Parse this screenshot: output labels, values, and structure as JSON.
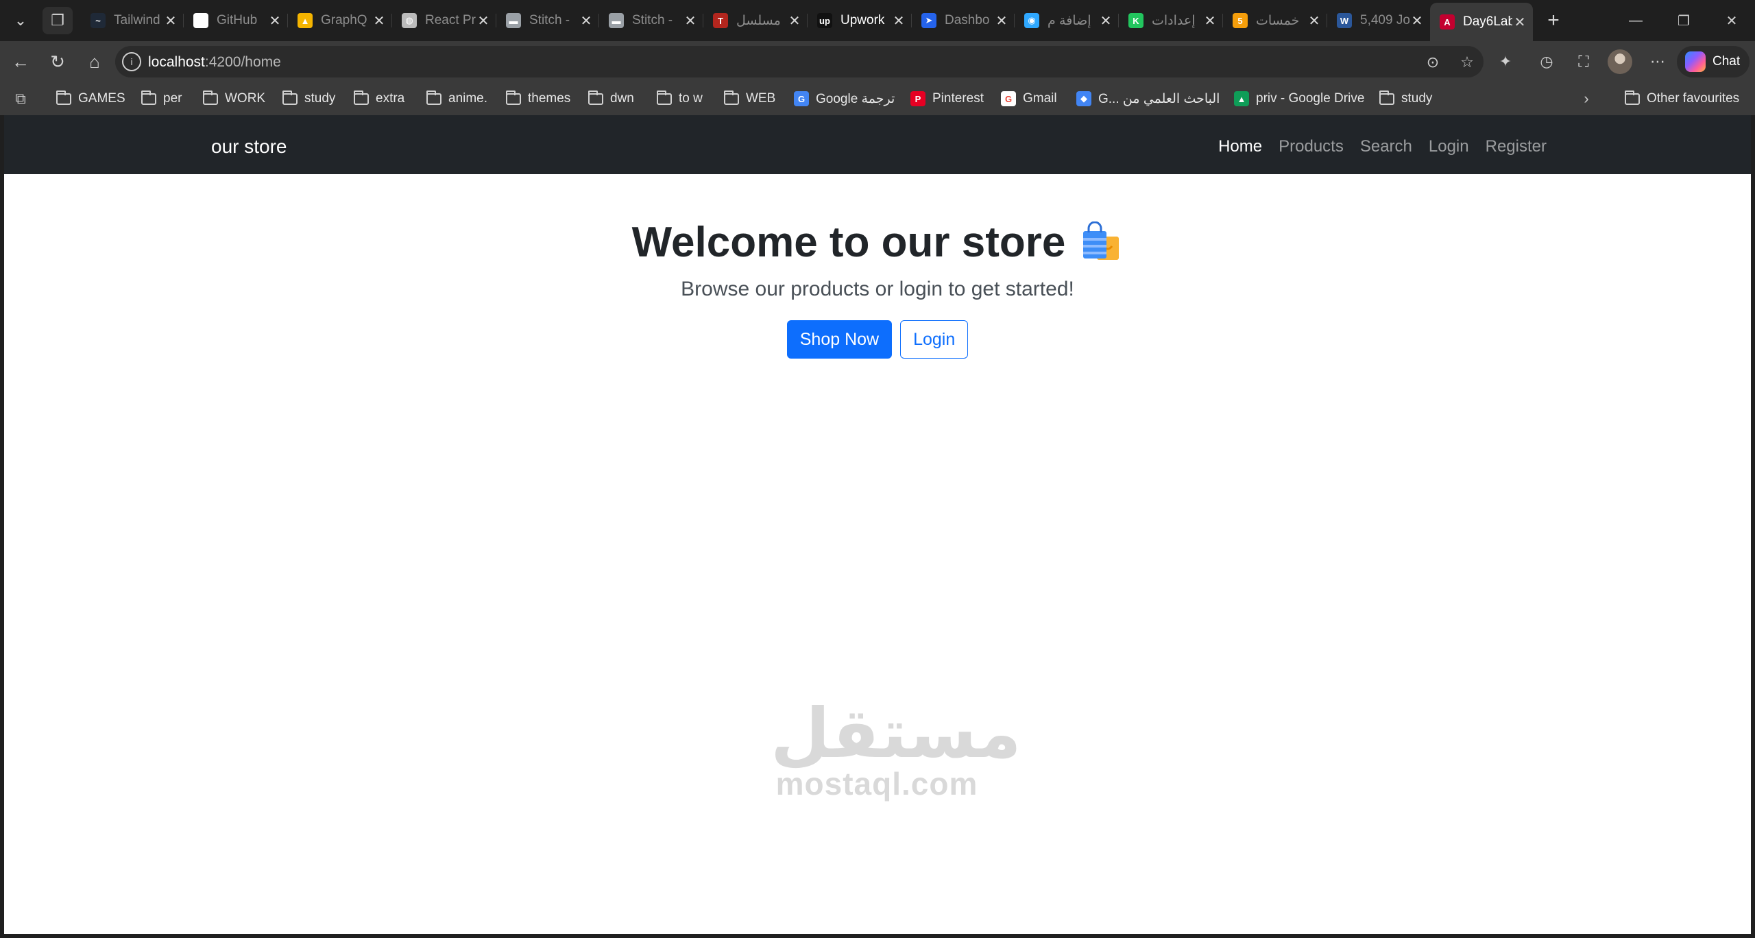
{
  "browser": {
    "tabs": [
      {
        "title": "Tailwind",
        "icon": "tailwind-icon",
        "color": "#1f2937"
      },
      {
        "title": "GitHub",
        "icon": "github-icon",
        "color": "#ffffff"
      },
      {
        "title": "GraphQ",
        "icon": "google-drive-icon",
        "color": "#f4b400"
      },
      {
        "title": "React Pr",
        "icon": "globe-icon",
        "color": "#bbbbbb"
      },
      {
        "title": "Stitch - ",
        "icon": "stitch-icon",
        "color": "#9aa0a6"
      },
      {
        "title": "Stitch - ",
        "icon": "stitch-icon",
        "color": "#9aa0a6"
      },
      {
        "title": "مسلسل",
        "icon": "top-icon",
        "color": "#b3261e"
      },
      {
        "title": "Upwork",
        "icon": "upwork-icon",
        "color": "#111111"
      },
      {
        "title": "Dashbo",
        "icon": "dashboard-icon",
        "color": "#2563eb"
      },
      {
        "title": "إضافة م",
        "icon": "circle-icon",
        "color": "#2fa8ff"
      },
      {
        "title": "إعدادات",
        "icon": "k-icon",
        "color": "#22c55e"
      },
      {
        "title": "خمسات",
        "icon": "khamsat-icon",
        "color": "#f59e0b"
      },
      {
        "title": "5,409 Jo",
        "icon": "word-icon",
        "color": "#2b579a"
      },
      {
        "title": "Day6Lab",
        "icon": "angular-icon",
        "color": "#c3002f"
      }
    ],
    "active_tab": 13,
    "url_host": "localhost",
    "url_path": ":4200/home",
    "chat_label": "Chat",
    "bookmarks": [
      {
        "label": "GAMES",
        "type": "folder"
      },
      {
        "label": "per",
        "type": "folder"
      },
      {
        "label": "WORK",
        "type": "folder"
      },
      {
        "label": "study",
        "type": "folder"
      },
      {
        "label": "extra",
        "type": "folder"
      },
      {
        "label": "anime.",
        "type": "folder"
      },
      {
        "label": "themes",
        "type": "folder"
      },
      {
        "label": "dwn",
        "type": "folder"
      },
      {
        "label": "to w",
        "type": "folder"
      },
      {
        "label": "WEB",
        "type": "folder"
      },
      {
        "label": "Google ترجمة",
        "type": "site",
        "icon": "google-translate-icon"
      },
      {
        "label": "Pinterest",
        "type": "site",
        "icon": "pinterest-icon"
      },
      {
        "label": "Gmail",
        "type": "site",
        "icon": "google-icon"
      },
      {
        "label": "G... الباحث العلمي من",
        "type": "site",
        "icon": "scholar-icon"
      },
      {
        "label": "priv - Google Drive",
        "type": "site",
        "icon": "google-drive-icon"
      },
      {
        "label": "study",
        "type": "folder"
      }
    ],
    "other_favourites": "Other favourites"
  },
  "site": {
    "brand": "our store",
    "nav": [
      "Home",
      "Products",
      "Search",
      "Login",
      "Register"
    ],
    "active_nav": "Home",
    "hero_title": "Welcome to our store",
    "hero_subtitle": "Browse our products or login to get started!",
    "primary_button": "Shop Now",
    "secondary_button": "Login"
  },
  "watermark": {
    "arabic": "مستقل",
    "latin": "mostaql.com"
  }
}
